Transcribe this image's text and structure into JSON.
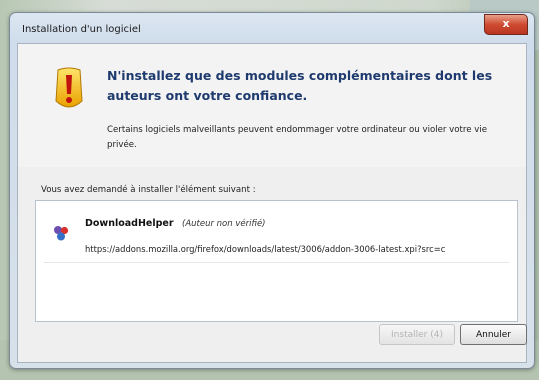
{
  "window": {
    "title": "Installation d'un logiciel",
    "close_label": "x"
  },
  "warning": {
    "headline": "N'installez que des modules complémentaires dont les auteurs ont votre confiance.",
    "subtext": "Certains logiciels malveillants peuvent endommager votre ordinateur ou violer votre vie privée."
  },
  "request_label": "Vous avez demandé à installer l'élément suivant :",
  "addon": {
    "name": "DownloadHelper",
    "author_note": "(Auteur non vérifié)",
    "url": "https://addons.mozilla.org/firefox/downloads/latest/3006/addon-3006-latest.xpi?src=c"
  },
  "buttons": {
    "install": "Installer (4)",
    "cancel": "Annuler"
  },
  "colors": {
    "headline": "#1e3a6e",
    "close": "#cf4b32",
    "warning_icon": "#f0b400"
  },
  "icons": {
    "warning": "warning-icon",
    "addon": "addon-icon",
    "close": "close-icon"
  }
}
